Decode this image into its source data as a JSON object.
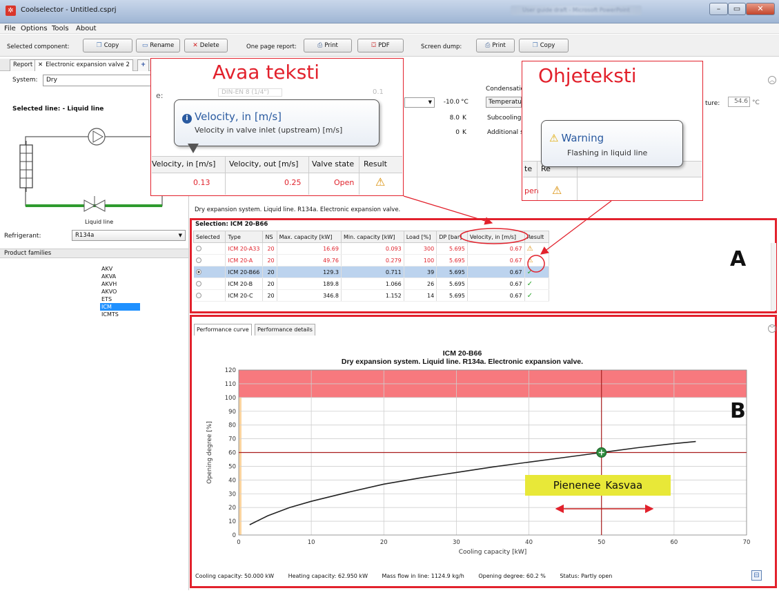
{
  "window": {
    "title": "Coolselector - Untitled.csprj",
    "blurred_title": "User guide draft - Microsoft PowerPoint"
  },
  "menu": [
    "File",
    "Options",
    "Tools",
    "About"
  ],
  "toolbar": {
    "selected_component_label": "Selected component:",
    "copy": "Copy",
    "rename": "Rename",
    "delete": "Delete",
    "one_page_report_label": "One page report:",
    "print": "Print",
    "pdf": "PDF",
    "screen_dump_label": "Screen dump:",
    "print2": "Print",
    "copy2": "Copy"
  },
  "tabs": {
    "report": "Report",
    "eev": "Electronic expansion valve 2",
    "add": "+"
  },
  "left": {
    "system_label": "System:",
    "system_value": "Dry",
    "selected_line": "Selected line: - Liquid line",
    "liquid_line": "Liquid line",
    "refrigerant_label": "Refrigerant:",
    "refrigerant_value": "R134a",
    "product_families_label": "Product families",
    "families": [
      "AKV",
      "AKVA",
      "AKVH",
      "AKVO",
      "ETS",
      "ICM",
      "ICMTS"
    ],
    "selected_family": "ICM"
  },
  "topform": {
    "evap_unit": "°C",
    "evap_value": "-10.0",
    "superheat_value": "8.0",
    "superheat_unit": "K",
    "sub_value": "0",
    "sub_unit": "K",
    "condensation": "Condensation",
    "temperature_btn": "Temperature",
    "subcooling": "Subcooling:",
    "additional": "Additional su",
    "temp_label": "ture:",
    "temp_value": "54.6",
    "temp_unit": "°C",
    "connection": "DIN-EN 8 (1/4\")",
    "conn_label": "e:",
    "conn_value": "0.1"
  },
  "dry_info": "Dry expansion system. Liquid line. R134a. Electronic expansion valve.",
  "selection_title": "Selection: ICM 20-B66",
  "table": {
    "headers": [
      "Selected",
      "Type",
      "NS",
      "Max. capacity [kW]",
      "Min. capacity [kW]",
      "Load [%]",
      "DP [bar]",
      "Velocity, in [m/s]",
      "Result"
    ],
    "rows": [
      {
        "type": "ICM 20-A33",
        "ns": "20",
        "max": "16.69",
        "min": "0.093",
        "load": "300",
        "dp": "5.695",
        "vel": "0.67",
        "result": "warn",
        "state": "red"
      },
      {
        "type": "ICM 20-A",
        "ns": "20",
        "max": "49.76",
        "min": "0.279",
        "load": "100",
        "dp": "5.695",
        "vel": "0.67",
        "result": "warn",
        "state": "red"
      },
      {
        "type": "ICM 20-B66",
        "ns": "20",
        "max": "129.3",
        "min": "0.711",
        "load": "39",
        "dp": "5.695",
        "vel": "0.67",
        "result": "ok",
        "state": "selected"
      },
      {
        "type": "ICM 20-B",
        "ns": "20",
        "max": "189.8",
        "min": "1.066",
        "load": "26",
        "dp": "5.695",
        "vel": "0.67",
        "result": "ok",
        "state": "normal"
      },
      {
        "type": "ICM 20-C",
        "ns": "20",
        "max": "346.8",
        "min": "1.152",
        "load": "14",
        "dp": "5.695",
        "vel": "0.67",
        "result": "ok",
        "state": "normal"
      }
    ]
  },
  "perf_tabs": [
    "Performance curve",
    "Performance details"
  ],
  "chart_data": {
    "type": "line",
    "title": "ICM 20-B66",
    "subtitle": "Dry expansion system. Liquid line. R134a. Electronic expansion valve.",
    "xlabel": "Cooling capacity [kW]",
    "ylabel": "Opening degree [%]",
    "xlim": [
      0,
      70
    ],
    "ylim": [
      0,
      120
    ],
    "xticks": [
      0,
      10,
      20,
      30,
      40,
      50,
      60,
      70
    ],
    "yticks": [
      0,
      10,
      20,
      30,
      40,
      50,
      60,
      70,
      80,
      90,
      100,
      110,
      120
    ],
    "grid": true,
    "overload_band": [
      100,
      120
    ],
    "x": [
      1.5,
      4,
      7,
      10,
      15,
      20,
      25,
      30,
      35,
      40,
      45,
      50,
      55,
      60,
      63
    ],
    "y": [
      7.5,
      14,
      20,
      24.5,
      31,
      37,
      41.5,
      45.5,
      49.5,
      53,
      56.5,
      60,
      63.5,
      66.5,
      68
    ],
    "operating_point": {
      "x": 50,
      "y": 60
    },
    "colors": {
      "band": "#f7797e",
      "line": "#222222",
      "crosshair": "#a81c1c",
      "point": "#2f8a3d"
    }
  },
  "status": {
    "cooling": "Cooling capacity:  50.000 kW",
    "heating": "Heating capacity: 62.950 kW",
    "massflow": "Mass flow in line: 1124.9 kg/h",
    "opening": "Opening degree: 60.2 %",
    "state": "Status: Partly open"
  },
  "annotations": {
    "left_title": "Avaa teksti",
    "right_title": "Ohjeteksti",
    "left_tooltip_title": "Velocity, in [m/s]",
    "left_tooltip_text": "Velocity in valve inlet (upstream) [m/s]",
    "right_tooltip_title": "Warning",
    "right_tooltip_text": "Flashing in liquid line",
    "zoom_headers": [
      "Velocity, in [m/s]",
      "Velocity, out [m/s]",
      "Valve state",
      "Result"
    ],
    "zoom_values": [
      "0.13",
      "0.25",
      "Open"
    ],
    "zoom_right_headers": [
      "te",
      "Re"
    ],
    "zoom_right_value": "pen",
    "letter_a": "A",
    "letter_b": "B",
    "yellow": "Pienenee  Kasvaa",
    "colors": {
      "red": "#e2212c",
      "yellow": "#e8e838"
    }
  }
}
